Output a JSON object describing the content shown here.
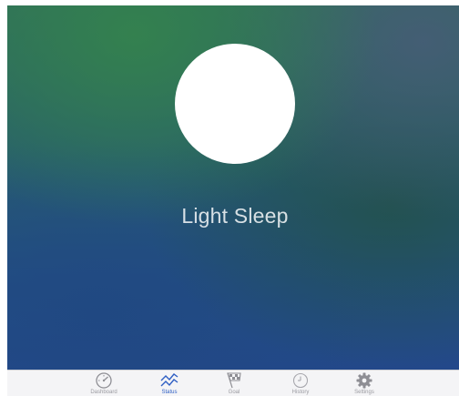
{
  "status": {
    "sleep_state": "Light Sleep"
  },
  "tabbar": {
    "tabs": [
      {
        "label": "Dashboard",
        "icon": "speedometer-icon",
        "active": false
      },
      {
        "label": "Status",
        "icon": "graph-icon",
        "active": true
      },
      {
        "label": "Goal",
        "icon": "checkered-flag-icon",
        "active": false
      },
      {
        "label": "History",
        "icon": "clock-icon",
        "active": false
      },
      {
        "label": "Settings",
        "icon": "gear-icon",
        "active": false
      }
    ]
  },
  "colors": {
    "accent": "#2f5fc4",
    "inactive": "#9a9aa0",
    "tabbar_bg": "#f4f4f6"
  }
}
